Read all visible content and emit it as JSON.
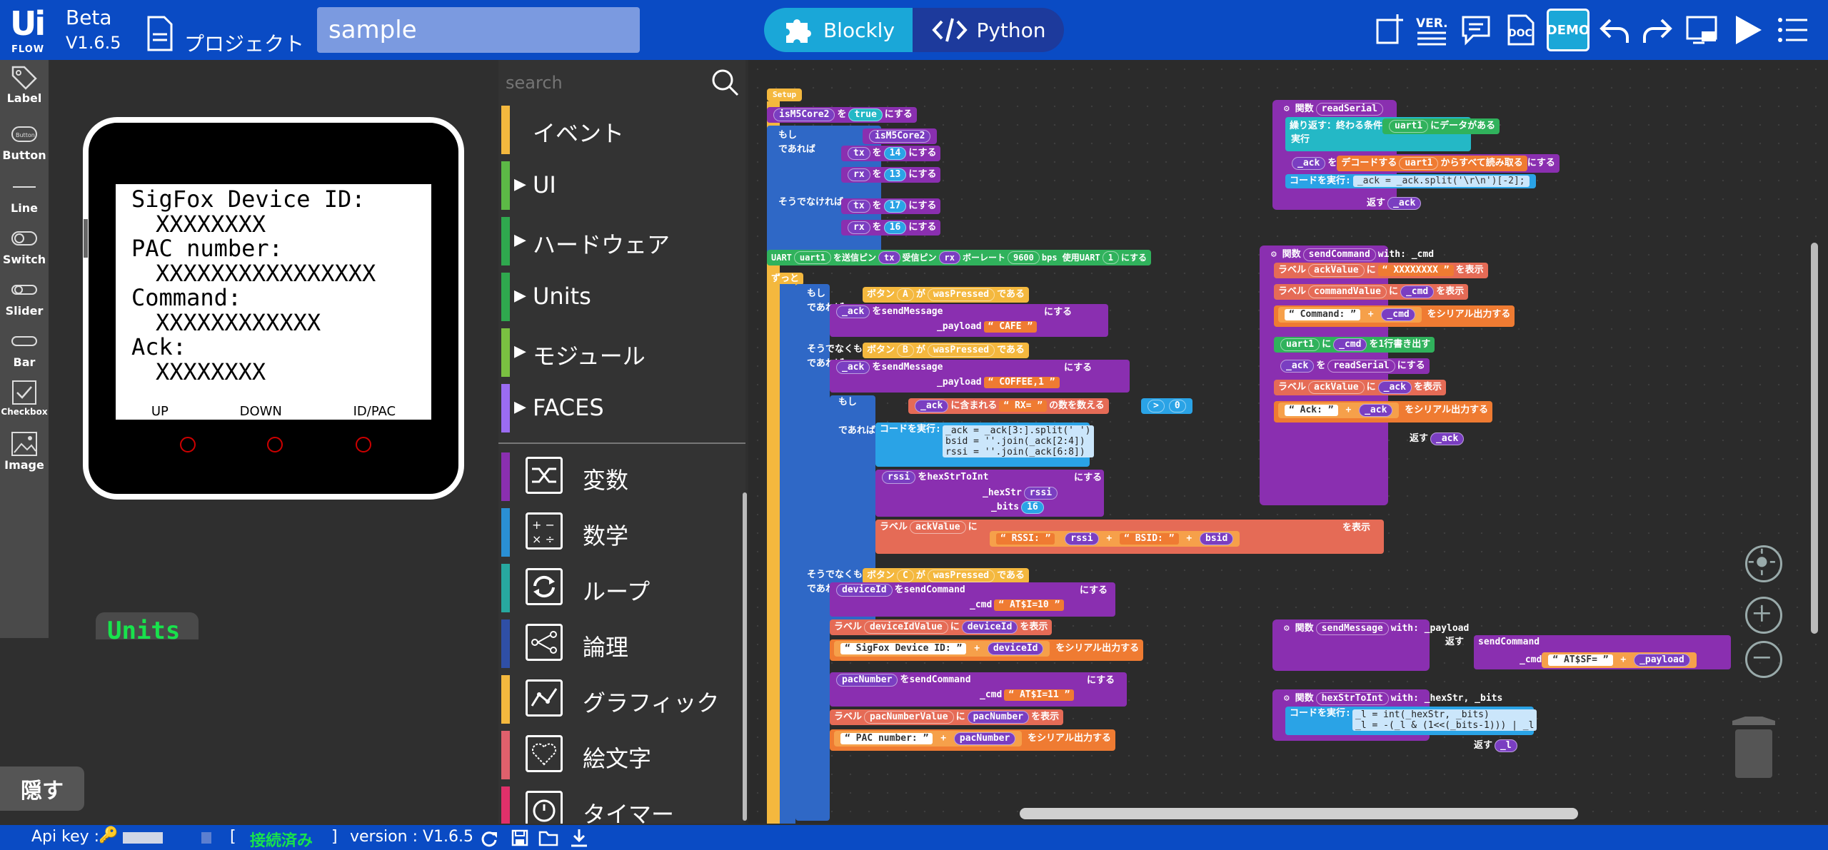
{
  "header": {
    "logo_ui": "Ui",
    "logo_flow": "FLOW",
    "beta": "Beta",
    "version": "V1.6.5",
    "project_label": "プロジェクト",
    "project_name": "sample",
    "mode_blockly": "Blockly",
    "mode_python": "Python",
    "toolbar_icons": [
      "new-file-icon",
      "version-icon",
      "chat-icon",
      "doc-icon",
      "demo-icon",
      "undo-icon",
      "redo-icon",
      "device-icon",
      "run-icon",
      "menu-icon"
    ],
    "ver_label": "VER.",
    "doc_label": "DOC",
    "demo_label": "DEMO"
  },
  "palette": [
    {
      "label": "Label",
      "icon": "tag-icon"
    },
    {
      "label": "Button",
      "icon": "button-icon"
    },
    {
      "label": "Line",
      "icon": "line-icon"
    },
    {
      "label": "Switch",
      "icon": "switch-icon"
    },
    {
      "label": "Slider",
      "icon": "slider-icon"
    },
    {
      "label": "Bar",
      "icon": "bar-icon"
    },
    {
      "label": "Checkbox",
      "icon": "checkbox-icon"
    },
    {
      "label": "Image",
      "icon": "image-icon"
    }
  ],
  "palette_button_text": "Button",
  "device": {
    "line1": "SigFox Device ID:",
    "line2": "XXXXXXXX",
    "line3": "PAC number:",
    "line4": "XXXXXXXXXXXXXXXX",
    "line5": "Command:",
    "line6": "XXXXXXXXXXXX",
    "line7": "Ack:",
    "line8": "XXXXXXXX",
    "btn_a": "UP",
    "btn_b": "DOWN",
    "btn_c": "ID/PAC"
  },
  "units_tab": "Units",
  "hide_button": "隠す",
  "search": {
    "placeholder": "search"
  },
  "categories": [
    {
      "label": "イベント",
      "color": "#f4b83e",
      "expand": false
    },
    {
      "label": "UI",
      "color": "#5cb946",
      "expand": true
    },
    {
      "label": "ハードウェア",
      "color": "#2fa84e",
      "expand": true
    },
    {
      "label": "Units",
      "color": "#2fa84e",
      "expand": true
    },
    {
      "label": "モジュール",
      "color": "#7ac041",
      "expand": true
    },
    {
      "label": "FACES",
      "color": "#9b6cf2",
      "expand": true
    },
    {
      "label": "変数",
      "color": "#8a2fb0",
      "icon": "shuffle-icon"
    },
    {
      "label": "数学",
      "color": "#2a8fd4",
      "icon": "math-icon"
    },
    {
      "label": "ループ",
      "color": "#27a8a0",
      "icon": "loop-icon"
    },
    {
      "label": "論理",
      "color": "#2f4fa6",
      "icon": "logic-icon"
    },
    {
      "label": "グラフィック",
      "color": "#f4b83e",
      "icon": "graphic-icon"
    },
    {
      "label": "絵文字",
      "color": "#e0606c",
      "icon": "emoji-icon"
    },
    {
      "label": "タイマー",
      "color": "#e0306a",
      "icon": "timer-icon"
    }
  ],
  "blocks": {
    "setup": "Setup",
    "b1": [
      "isM5Core2",
      "を",
      "true",
      "にする"
    ],
    "b2": [
      "もし",
      "isM5Core2",
      "であれば"
    ],
    "b3": [
      "tx",
      "を",
      "14",
      "にする"
    ],
    "b4": [
      "rx",
      "を",
      "13",
      "にする"
    ],
    "b5": "そうでなければ",
    "b6": [
      "tx",
      "を",
      "17",
      "にする"
    ],
    "b7": [
      "rx",
      "を",
      "16",
      "にする"
    ],
    "uart": [
      "UART",
      "uart1",
      "を送信ピン",
      "tx",
      "受信ピン",
      "rx",
      "ボーレート",
      "9600",
      "bps 使用UART",
      "1",
      "にする"
    ],
    "loop": "ずっと",
    "if_a": [
      "もし",
      "ボタン",
      "A",
      "が",
      "wasPressed",
      "である"
    ],
    "then": "であれば",
    "ack1": [
      "_ack",
      "を",
      "sendMessage",
      "_payload",
      "CAFE",
      "にする"
    ],
    "elif_b": [
      "そうでなくもし",
      "ボタン",
      "B",
      "が",
      "wasPressed",
      "である"
    ],
    "ack2": [
      "_ack",
      "を",
      "sendMessage",
      "_payload",
      "COFFEE,1",
      "にする"
    ],
    "if_rx": [
      "もし",
      "_ack",
      "に含まれる",
      "RX=",
      "の数を数える",
      ">",
      "0"
    ],
    "code1": [
      "コードを実行:",
      "_ack = _ack[3:].split(' ')",
      "bsid = ''.join(_ack[2:4])",
      "rssi = ''.join(_ack[6:8])"
    ],
    "rssi": [
      "rssi",
      "を",
      "hexStrToInt",
      "_hexStr",
      "rssi",
      "_bits",
      "16",
      "にする"
    ],
    "label_ack": [
      "ラベル",
      "ackValue",
      "に",
      "RSSI:",
      "rssi",
      "BSID:",
      "bsid",
      "を表示"
    ],
    "elif_c": [
      "そうでなくもし",
      "ボタン",
      "C",
      "が",
      "wasPressed",
      "である"
    ],
    "devid": [
      "deviceId",
      "を",
      "sendCommand",
      "_cmd",
      "AT$I=10",
      "にする"
    ],
    "label_dev": [
      "ラベル",
      "deviceIdValue",
      "に",
      "deviceId",
      "を表示"
    ],
    "serial_dev": [
      "SigFox Device ID:",
      "deviceId",
      "をシリアル出力する"
    ],
    "pac": [
      "pacNumber",
      "を",
      "sendCommand",
      "_cmd",
      "AT$I=11",
      "にする"
    ],
    "label_pac": [
      "ラベル",
      "pacNumberValue",
      "に",
      "pacNumber",
      "を表示"
    ],
    "serial_pac": [
      "PAC number:",
      "pacNumber",
      "をシリアル出力する"
    ],
    "fn_read": [
      "関数",
      "readSerial"
    ],
    "read_loop": [
      "繰り返す：終わる条件",
      "uart1",
      "にデータがある"
    ],
    "read_do": "実行",
    "read_ack": [
      "_ack",
      "を",
      "デコードする",
      "uart1",
      "からすべて読み取る",
      "にする"
    ],
    "read_code": [
      "コードを実行:",
      "_ack = _ack.split('\\r\\n')[-2];"
    ],
    "read_ret": [
      "返す",
      "_ack"
    ],
    "fn_send": [
      "関数",
      "sendCommand",
      "with: _cmd"
    ],
    "s1": [
      "ラベル",
      "ackValue",
      "に",
      "XXXXXXXX",
      "を表示"
    ],
    "s2": [
      "ラベル",
      "commandValue",
      "に",
      "_cmd",
      "を表示"
    ],
    "s3": [
      "Command:",
      "_cmd",
      "をシリアル出力する"
    ],
    "s4": [
      "uart1",
      "に",
      "_cmd",
      "を1行書き出す"
    ],
    "s5": [
      "_ack",
      "を",
      "readSerial",
      "にする"
    ],
    "s6": [
      "ラベル",
      "ackValue",
      "に",
      "_ack",
      "を表示"
    ],
    "s7": [
      "Ack:",
      "_ack",
      "をシリアル出力する"
    ],
    "s_ret": [
      "返す",
      "_ack"
    ],
    "fn_msg": [
      "関数",
      "sendMessage",
      "with: _payload"
    ],
    "msg_ret": [
      "返す",
      "sendCommand",
      "_cmd",
      "AT$SF=",
      "_payload"
    ],
    "fn_hex": [
      "関数",
      "hexStrToInt",
      "with: _hexStr, _bits"
    ],
    "hex_code": [
      "コードを実行:",
      "_l = int(_hexStr, _bits)",
      "_l = -(_l & (1<<(_bits-1))) | _l"
    ],
    "hex_ret": [
      "返す",
      "_l"
    ]
  },
  "status": {
    "api_key": "Api key :",
    "bracket_open": "[",
    "connected": "接続済み",
    "bracket_close": "]",
    "version": "version : V1.6.5"
  }
}
